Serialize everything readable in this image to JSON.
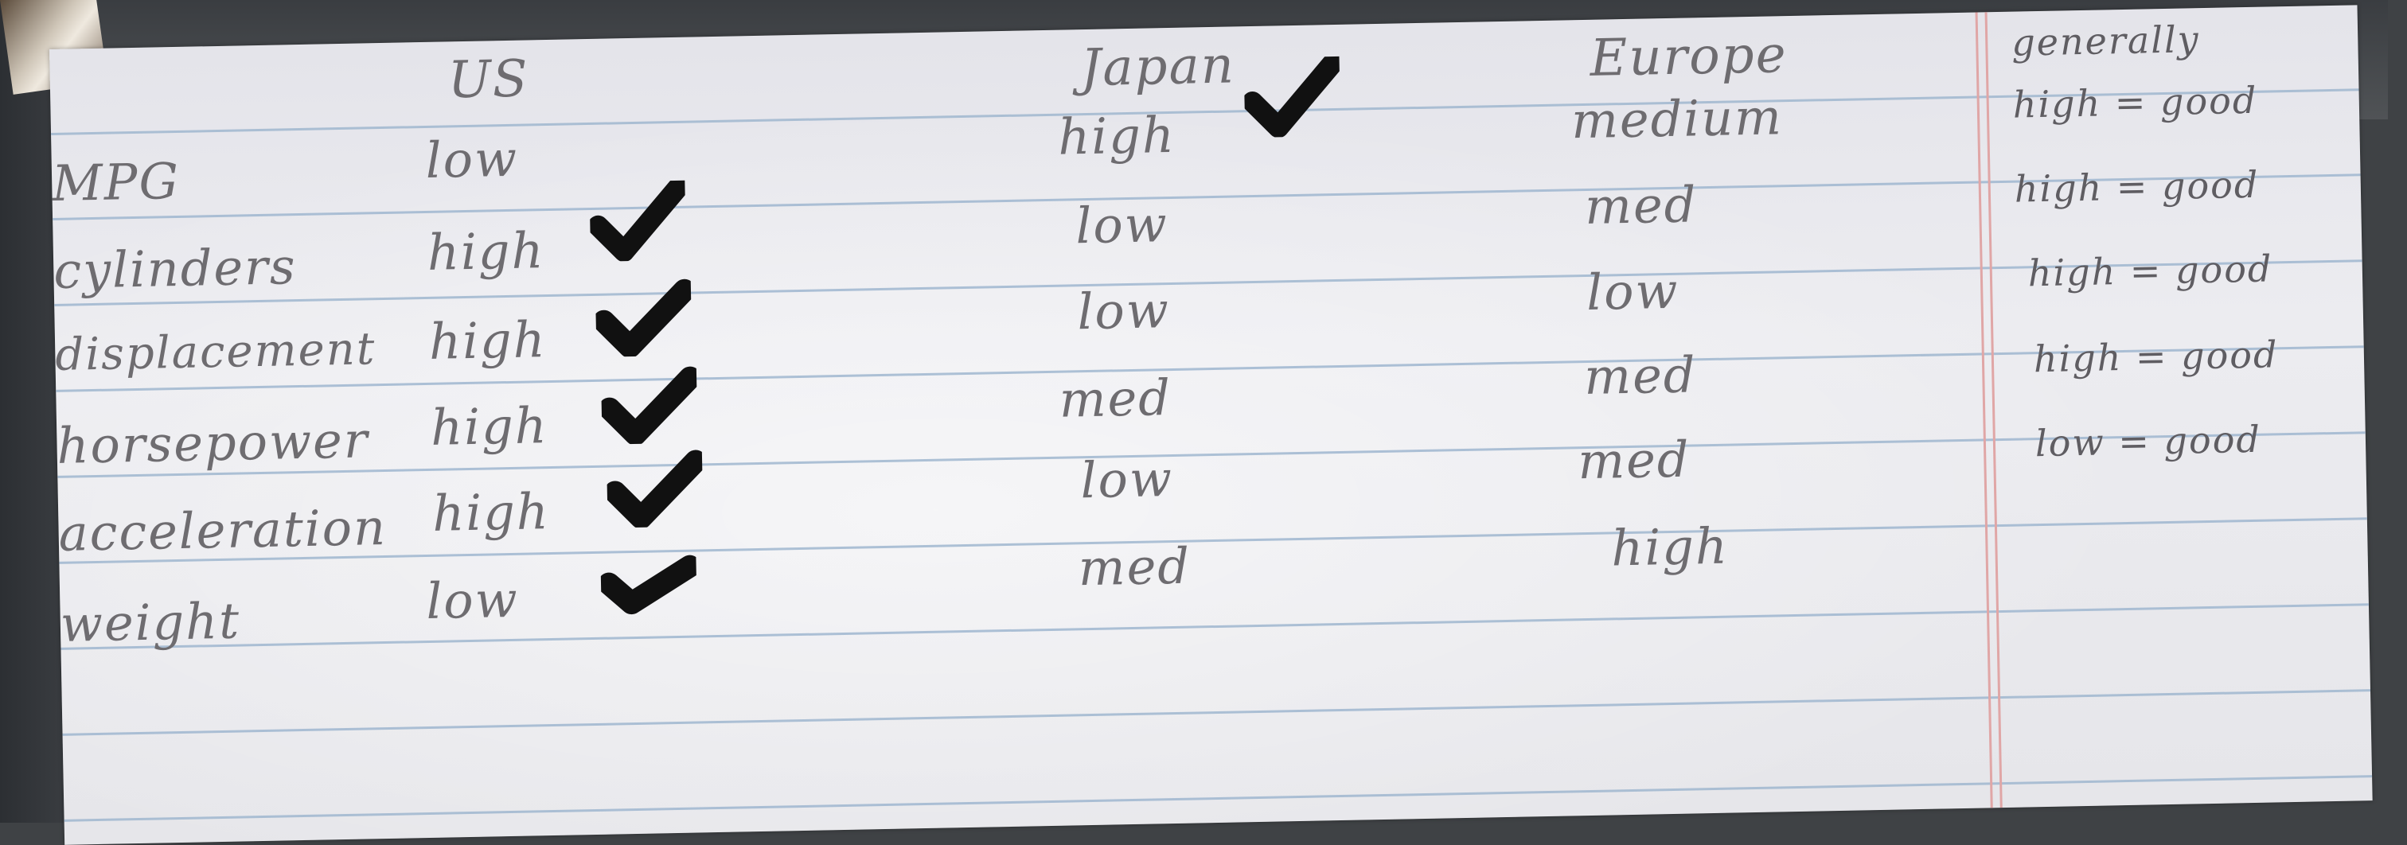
{
  "columns": {
    "us": "US",
    "japan": "Japan",
    "europe": "Europe",
    "generally": "generally"
  },
  "rows": [
    {
      "label": "MPG",
      "us": "low",
      "japan": "high",
      "europe": "medium",
      "generally": "high = good"
    },
    {
      "label": "cylinders",
      "us": "high",
      "japan": "low",
      "europe": "med",
      "generally": "high = good"
    },
    {
      "label": "displacement",
      "us": "high",
      "japan": "low",
      "europe": "low",
      "generally": "high = good"
    },
    {
      "label": "horsepower",
      "us": "high",
      "japan": "med",
      "europe": "med",
      "generally": "high = good"
    },
    {
      "label": "acceleration",
      "us": "high",
      "japan": "low",
      "europe": "med",
      "generally": "low = good"
    },
    {
      "label": "weight",
      "us": "low",
      "japan": "med",
      "europe": "high",
      "generally": ""
    }
  ],
  "checkmarks": [
    "mpg-japan",
    "cylinders-us",
    "displacement-us",
    "horsepower-us",
    "acceleration-us",
    "weight-us"
  ],
  "colors": {
    "ink": "#6e6c70",
    "check": "#111111",
    "rule": "#9fb6cf",
    "margin": "#e0a6a6"
  },
  "icons": {
    "checkmark": "check-icon"
  }
}
